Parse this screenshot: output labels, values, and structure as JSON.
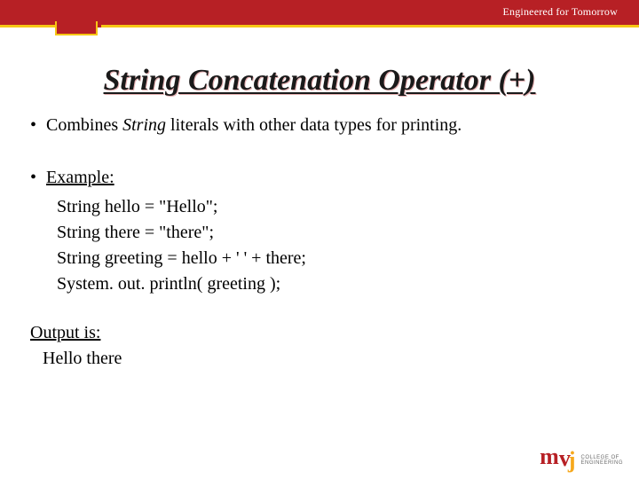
{
  "header": {
    "tagline": "Engineered for Tomorrow"
  },
  "title": "String Concatenation Operator (+)",
  "bullets": {
    "b1_prefix": "Combines ",
    "b1_em": "String",
    "b1_suffix": " literals with other data types for printing.",
    "example_label": "Example:"
  },
  "code": {
    "l1": "String hello = \"Hello\";",
    "l2": "String there = \"there\";",
    "l3": "String greeting = hello + ' ' + there;",
    "l4": "System. out. println( greeting );"
  },
  "output": {
    "label": "Output is:",
    "value": "Hello there"
  },
  "logo": {
    "m": "m",
    "v": "v",
    "j": "j",
    "line1": "COLLEGE OF",
    "line2": "ENGINEERING"
  }
}
